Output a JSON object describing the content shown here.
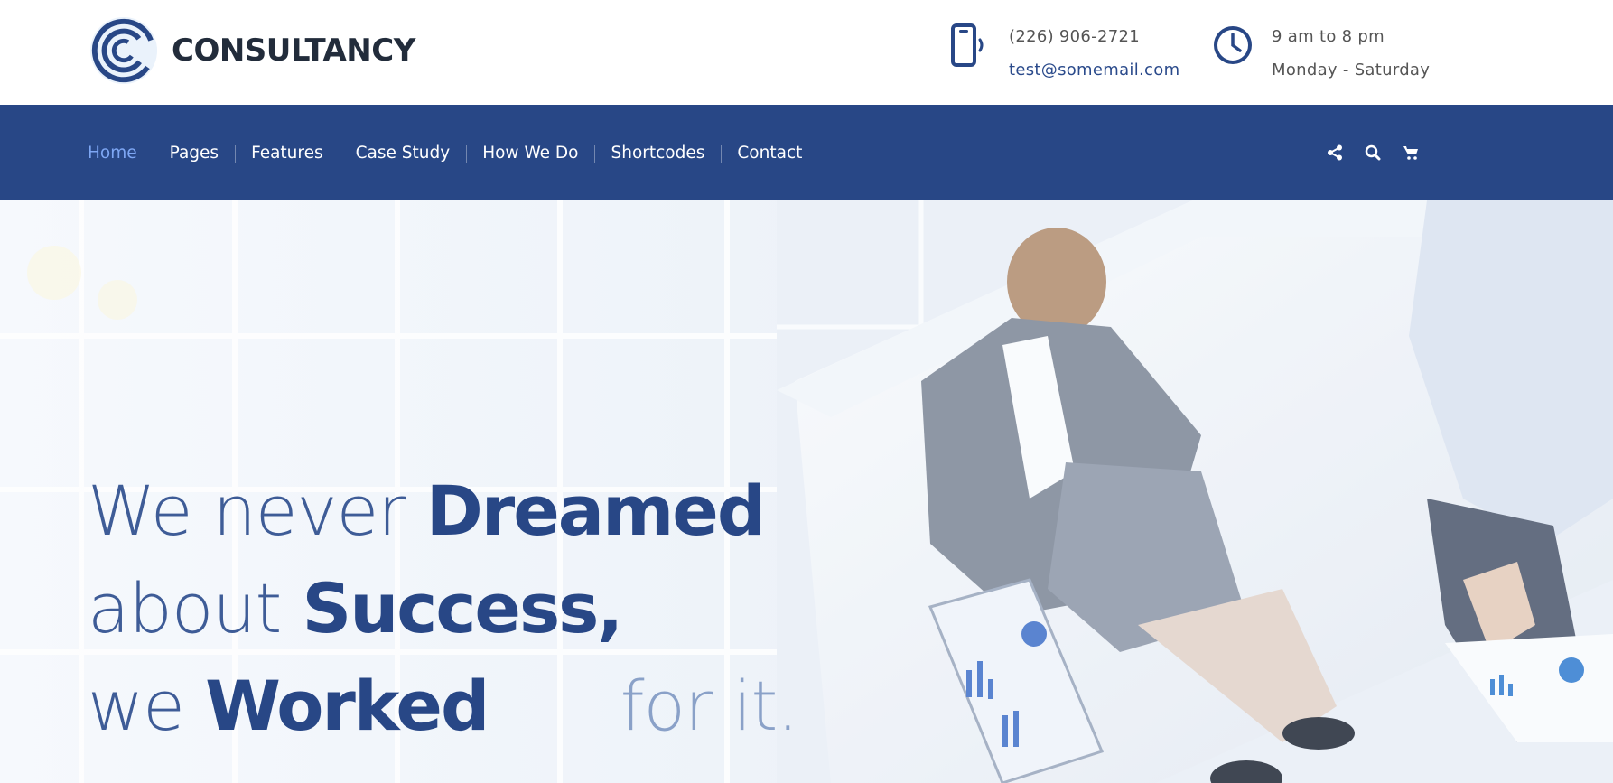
{
  "brand": {
    "name": "CONSULTANCY",
    "logo_icon": "c-circle-logo-icon"
  },
  "contact": {
    "phone": "(226) 906-2721",
    "email": "test@somemail.com",
    "phone_icon": "mobile-phone-icon",
    "hours": "9 am to 8 pm",
    "days": "Monday - Saturday",
    "hours_icon": "clock-icon"
  },
  "nav": {
    "items": [
      {
        "label": "Home"
      },
      {
        "label": "Pages"
      },
      {
        "label": "Features"
      },
      {
        "label": "Case Study"
      },
      {
        "label": "How We Do"
      },
      {
        "label": "Shortcodes"
      },
      {
        "label": "Contact"
      }
    ],
    "active_index": 0,
    "icons": [
      "share-icon",
      "search-icon",
      "cart-icon"
    ]
  },
  "hero": {
    "line1_thin": "We never",
    "line1_bold": "Dreamed",
    "line2_thin": "about",
    "line2_bold": "Success,",
    "line3_thin": "we",
    "line3_bold": "Worked",
    "line3_tail": "for it."
  },
  "colors": {
    "primary": "#284786",
    "nav_active": "#7ea7f4",
    "text_dark": "#222c3b",
    "text_muted": "#555555"
  }
}
